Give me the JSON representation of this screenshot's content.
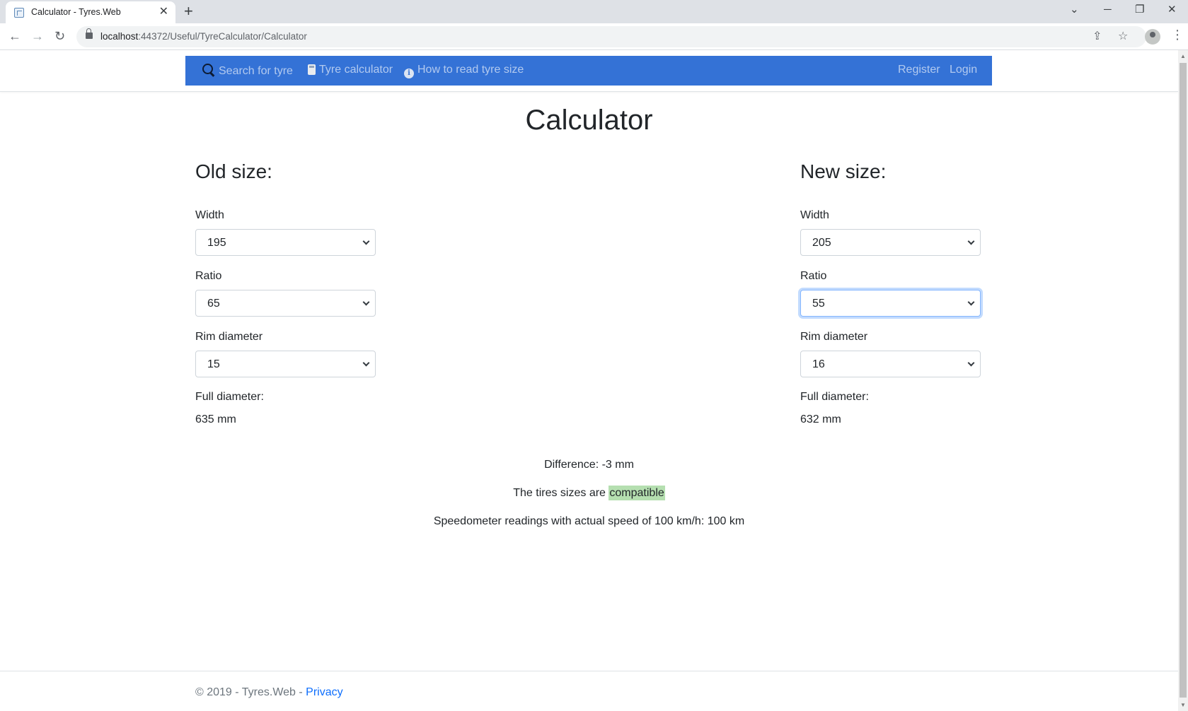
{
  "browser": {
    "tab_title": "Calculator - Tyres.Web",
    "url_host": "localhost",
    "url_path": ":44372/Useful/TyreCalculator/Calculator"
  },
  "navbar": {
    "search_label": "Search for tyre",
    "calculator_label": "Tyre calculator",
    "howto_label": "How to read tyre size",
    "info_glyph": "i",
    "register_label": "Register",
    "login_label": "Login",
    "background_color": "#3472d6"
  },
  "page": {
    "title": "Calculator"
  },
  "old_size": {
    "heading": "Old size:",
    "width_label": "Width",
    "width_value": "195",
    "ratio_label": "Ratio",
    "ratio_value": "65",
    "rim_label": "Rim diameter",
    "rim_value": "15",
    "full_label": "Full diameter:",
    "full_value": "635 mm"
  },
  "new_size": {
    "heading": "New size:",
    "width_label": "Width",
    "width_value": "205",
    "ratio_label": "Ratio",
    "ratio_value": "55",
    "rim_label": "Rim diameter",
    "rim_value": "16",
    "full_label": "Full diameter:",
    "full_value": "632 mm"
  },
  "results": {
    "difference": "Difference: -3 mm",
    "compat_prefix": "The tires sizes are ",
    "compat_value": "compatible",
    "compat_color": "#b5dfb0",
    "speedometer": "Speedometer readings with actual speed of 100 km/h: 100 km"
  },
  "footer": {
    "copyright": "© 2019 - Tyres.Web - ",
    "privacy_label": "Privacy"
  }
}
